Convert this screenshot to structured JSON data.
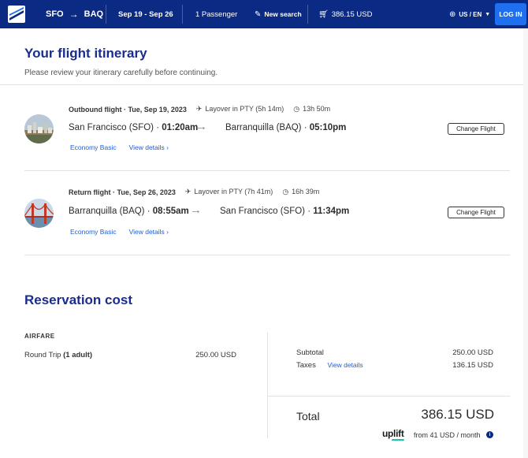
{
  "header": {
    "origin": "SFO",
    "arrow": "→",
    "destination": "BAQ",
    "dates": "Sep 19 - Sep 26",
    "passengers": "1 Passenger",
    "new_search": "New search",
    "price": "386.15 USD",
    "locale": "US / EN",
    "login": "LOG IN",
    "colors": {
      "bar": "#0a2a84",
      "login_bg": "#1f6ff1"
    }
  },
  "page": {
    "title": "Your flight itinerary",
    "subtitle": "Please review your itinerary carefully before continuing."
  },
  "flights": [
    {
      "label": "Outbound flight · Tue, Sep 19, 2023",
      "layover": "Layover in PTY (5h 14m)",
      "duration": "13h 50m",
      "from_city": "San Francisco (SFO) · ",
      "from_time": "01:20am",
      "to_city": "Barranquilla (BAQ) · ",
      "to_time": "05:10pm",
      "fare": "Economy Basic",
      "view_details": "View details",
      "change": "Change Flight",
      "thumb_icon": "city-skyline-photo-icon"
    },
    {
      "label": "Return flight · Tue, Sep 26, 2023",
      "layover": "Layover in PTY (7h 41m)",
      "duration": "16h 39m",
      "from_city": "Barranquilla (BAQ) · ",
      "from_time": "08:55am",
      "to_city": "San Francisco (SFO) · ",
      "to_time": "11:34pm",
      "fare": "Economy Basic",
      "view_details": "View details",
      "change": "Change Flight",
      "thumb_icon": "golden-gate-bridge-photo-icon"
    }
  ],
  "reservation": {
    "title": "Reservation cost",
    "airfare_label": "AIRFARE",
    "trip_label": "Round Trip ",
    "trip_detail": "(1 adult)",
    "trip_price": "250.00 USD",
    "subtotal_label": "Subtotal",
    "subtotal_value": "250.00 USD",
    "taxes_label": "Taxes",
    "taxes_link": "View details",
    "taxes_value": "136.15 USD",
    "total_label": "Total",
    "total_value": "386.15 USD",
    "uplift_brand": "uplift",
    "monthly": "from 41 USD  / month",
    "info_glyph": "i"
  }
}
